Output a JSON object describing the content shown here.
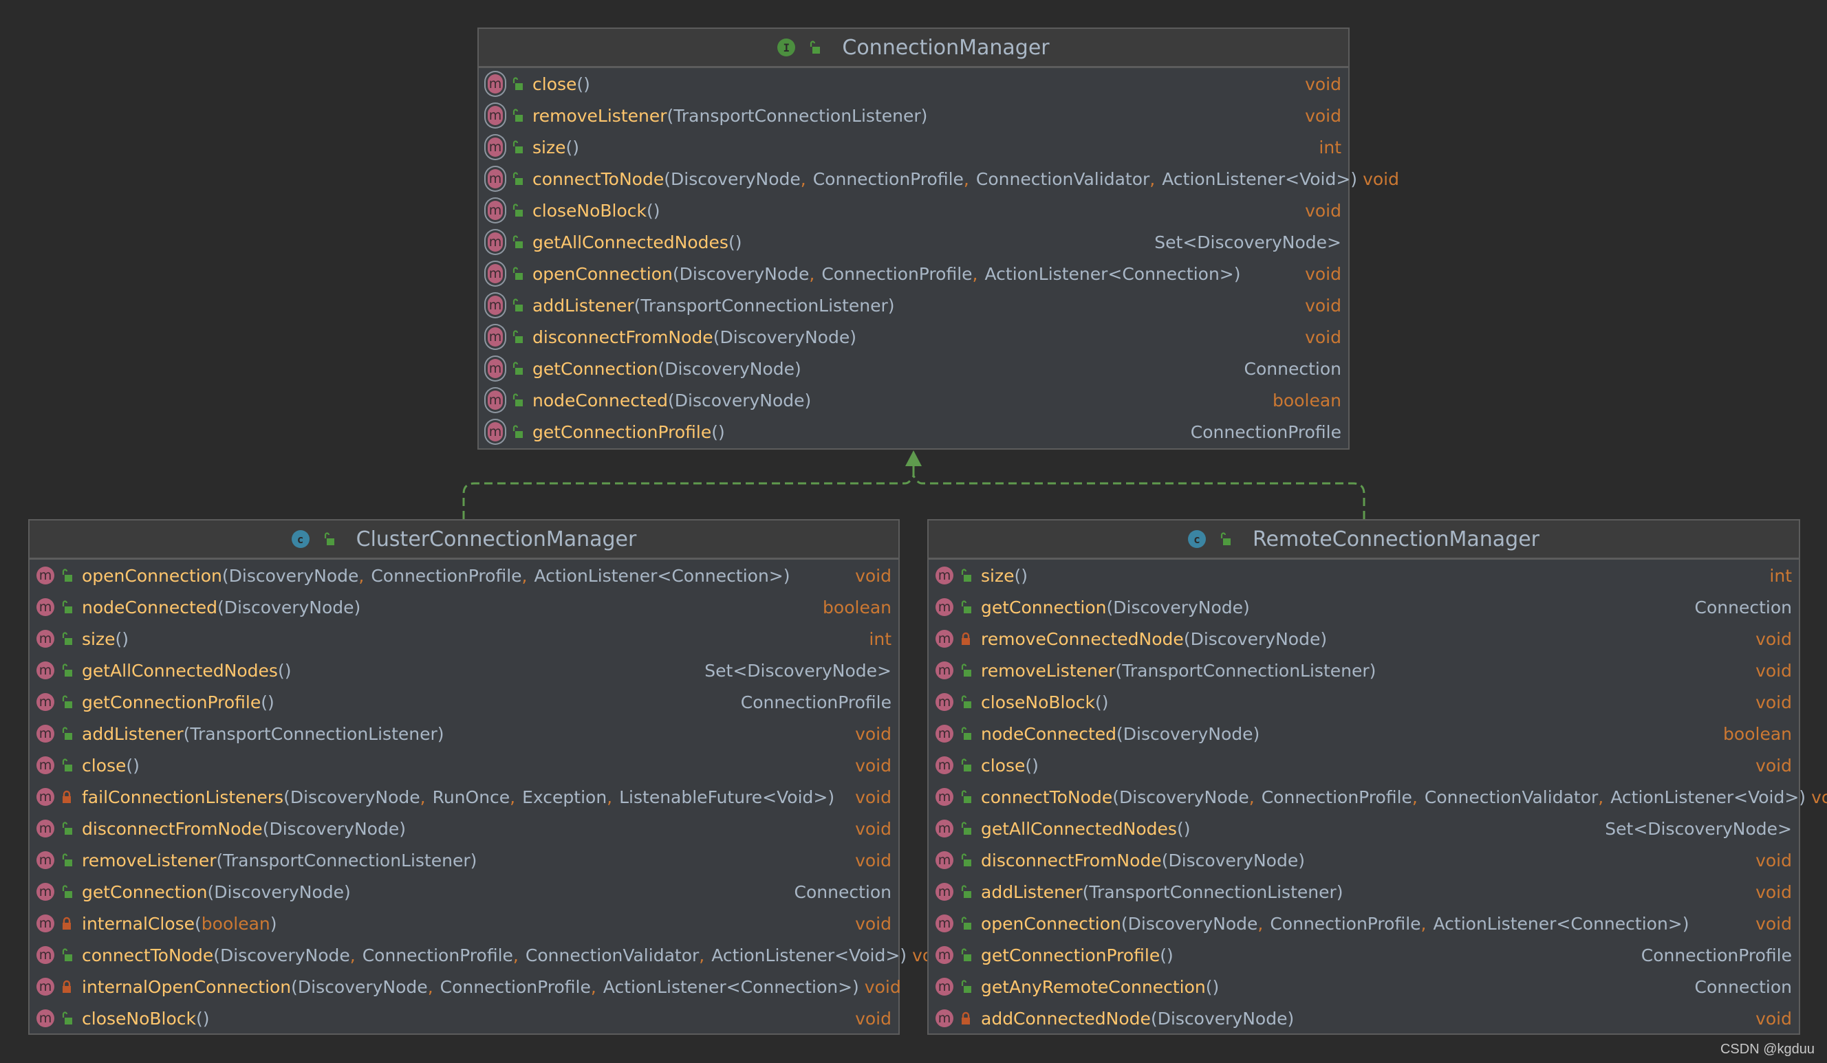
{
  "colors": {
    "method_name": "#ffc66d",
    "type": "#a9b7c6",
    "primitive": "#cc7832",
    "public_lock": "#4f9a3f",
    "private_lock": "#c0582a",
    "relation": "#5f9a4e"
  },
  "relation": {
    "type": "implements",
    "from": [
      "ClusterConnectionManager",
      "RemoteConnectionManager"
    ],
    "to": "ConnectionManager"
  },
  "watermark": "CSDN @kgduu",
  "boxes": [
    {
      "id": "connection-manager",
      "kind": "interface",
      "kind_icon": "I",
      "title": "ConnectionManager",
      "methods": [
        {
          "name": "close",
          "params": [],
          "ret": "void",
          "vis": "public",
          "abstract": true
        },
        {
          "name": "removeListener",
          "params": [
            "TransportConnectionListener"
          ],
          "ret": "void",
          "vis": "public",
          "abstract": true
        },
        {
          "name": "size",
          "params": [],
          "ret": "int",
          "vis": "public",
          "abstract": true
        },
        {
          "name": "connectToNode",
          "params": [
            "DiscoveryNode",
            "ConnectionProfile",
            "ConnectionValidator",
            "ActionListener<Void>"
          ],
          "ret": "void",
          "vis": "public",
          "abstract": true
        },
        {
          "name": "closeNoBlock",
          "params": [],
          "ret": "void",
          "vis": "public",
          "abstract": true
        },
        {
          "name": "getAllConnectedNodes",
          "params": [],
          "ret": "Set<DiscoveryNode>",
          "vis": "public",
          "abstract": true
        },
        {
          "name": "openConnection",
          "params": [
            "DiscoveryNode",
            "ConnectionProfile",
            "ActionListener<Connection>"
          ],
          "ret": "void",
          "vis": "public",
          "abstract": true
        },
        {
          "name": "addListener",
          "params": [
            "TransportConnectionListener"
          ],
          "ret": "void",
          "vis": "public",
          "abstract": true
        },
        {
          "name": "disconnectFromNode",
          "params": [
            "DiscoveryNode"
          ],
          "ret": "void",
          "vis": "public",
          "abstract": true
        },
        {
          "name": "getConnection",
          "params": [
            "DiscoveryNode"
          ],
          "ret": "Connection",
          "vis": "public",
          "abstract": true
        },
        {
          "name": "nodeConnected",
          "params": [
            "DiscoveryNode"
          ],
          "ret": "boolean",
          "vis": "public",
          "abstract": true
        },
        {
          "name": "getConnectionProfile",
          "params": [],
          "ret": "ConnectionProfile",
          "vis": "public",
          "abstract": true
        }
      ]
    },
    {
      "id": "cluster-connection-manager",
      "kind": "class",
      "kind_icon": "c",
      "title": "ClusterConnectionManager",
      "methods": [
        {
          "name": "openConnection",
          "params": [
            "DiscoveryNode",
            "ConnectionProfile",
            "ActionListener<Connection>"
          ],
          "ret": "void",
          "vis": "public"
        },
        {
          "name": "nodeConnected",
          "params": [
            "DiscoveryNode"
          ],
          "ret": "boolean",
          "vis": "public"
        },
        {
          "name": "size",
          "params": [],
          "ret": "int",
          "vis": "public"
        },
        {
          "name": "getAllConnectedNodes",
          "params": [],
          "ret": "Set<DiscoveryNode>",
          "vis": "public"
        },
        {
          "name": "getConnectionProfile",
          "params": [],
          "ret": "ConnectionProfile",
          "vis": "public"
        },
        {
          "name": "addListener",
          "params": [
            "TransportConnectionListener"
          ],
          "ret": "void",
          "vis": "public"
        },
        {
          "name": "close",
          "params": [],
          "ret": "void",
          "vis": "public"
        },
        {
          "name": "failConnectionListeners",
          "params": [
            "DiscoveryNode",
            "RunOnce",
            "Exception",
            "ListenableFuture<Void>"
          ],
          "ret": "void",
          "vis": "private"
        },
        {
          "name": "disconnectFromNode",
          "params": [
            "DiscoveryNode"
          ],
          "ret": "void",
          "vis": "public"
        },
        {
          "name": "removeListener",
          "params": [
            "TransportConnectionListener"
          ],
          "ret": "void",
          "vis": "public"
        },
        {
          "name": "getConnection",
          "params": [
            "DiscoveryNode"
          ],
          "ret": "Connection",
          "vis": "public"
        },
        {
          "name": "internalClose",
          "params": [
            "boolean"
          ],
          "ret": "void",
          "vis": "private"
        },
        {
          "name": "connectToNode",
          "params": [
            "DiscoveryNode",
            "ConnectionProfile",
            "ConnectionValidator",
            "ActionListener<Void>"
          ],
          "ret": "void",
          "vis": "public"
        },
        {
          "name": "internalOpenConnection",
          "params": [
            "DiscoveryNode",
            "ConnectionProfile",
            "ActionListener<Connection>"
          ],
          "ret": "void",
          "vis": "private"
        },
        {
          "name": "closeNoBlock",
          "params": [],
          "ret": "void",
          "vis": "public"
        }
      ]
    },
    {
      "id": "remote-connection-manager",
      "kind": "class",
      "kind_icon": "c",
      "title": "RemoteConnectionManager",
      "methods": [
        {
          "name": "size",
          "params": [],
          "ret": "int",
          "vis": "public"
        },
        {
          "name": "getConnection",
          "params": [
            "DiscoveryNode"
          ],
          "ret": "Connection",
          "vis": "public"
        },
        {
          "name": "removeConnectedNode",
          "params": [
            "DiscoveryNode"
          ],
          "ret": "void",
          "vis": "private"
        },
        {
          "name": "removeListener",
          "params": [
            "TransportConnectionListener"
          ],
          "ret": "void",
          "vis": "public"
        },
        {
          "name": "closeNoBlock",
          "params": [],
          "ret": "void",
          "vis": "public"
        },
        {
          "name": "nodeConnected",
          "params": [
            "DiscoveryNode"
          ],
          "ret": "boolean",
          "vis": "public"
        },
        {
          "name": "close",
          "params": [],
          "ret": "void",
          "vis": "public"
        },
        {
          "name": "connectToNode",
          "params": [
            "DiscoveryNode",
            "ConnectionProfile",
            "ConnectionValidator",
            "ActionListener<Void>"
          ],
          "ret": "void",
          "vis": "public"
        },
        {
          "name": "getAllConnectedNodes",
          "params": [],
          "ret": "Set<DiscoveryNode>",
          "vis": "public"
        },
        {
          "name": "disconnectFromNode",
          "params": [
            "DiscoveryNode"
          ],
          "ret": "void",
          "vis": "public"
        },
        {
          "name": "addListener",
          "params": [
            "TransportConnectionListener"
          ],
          "ret": "void",
          "vis": "public"
        },
        {
          "name": "openConnection",
          "params": [
            "DiscoveryNode",
            "ConnectionProfile",
            "ActionListener<Connection>"
          ],
          "ret": "void",
          "vis": "public"
        },
        {
          "name": "getConnectionProfile",
          "params": [],
          "ret": "ConnectionProfile",
          "vis": "public"
        },
        {
          "name": "getAnyRemoteConnection",
          "params": [],
          "ret": "Connection",
          "vis": "public"
        },
        {
          "name": "addConnectedNode",
          "params": [
            "DiscoveryNode"
          ],
          "ret": "void",
          "vis": "private"
        }
      ]
    }
  ]
}
